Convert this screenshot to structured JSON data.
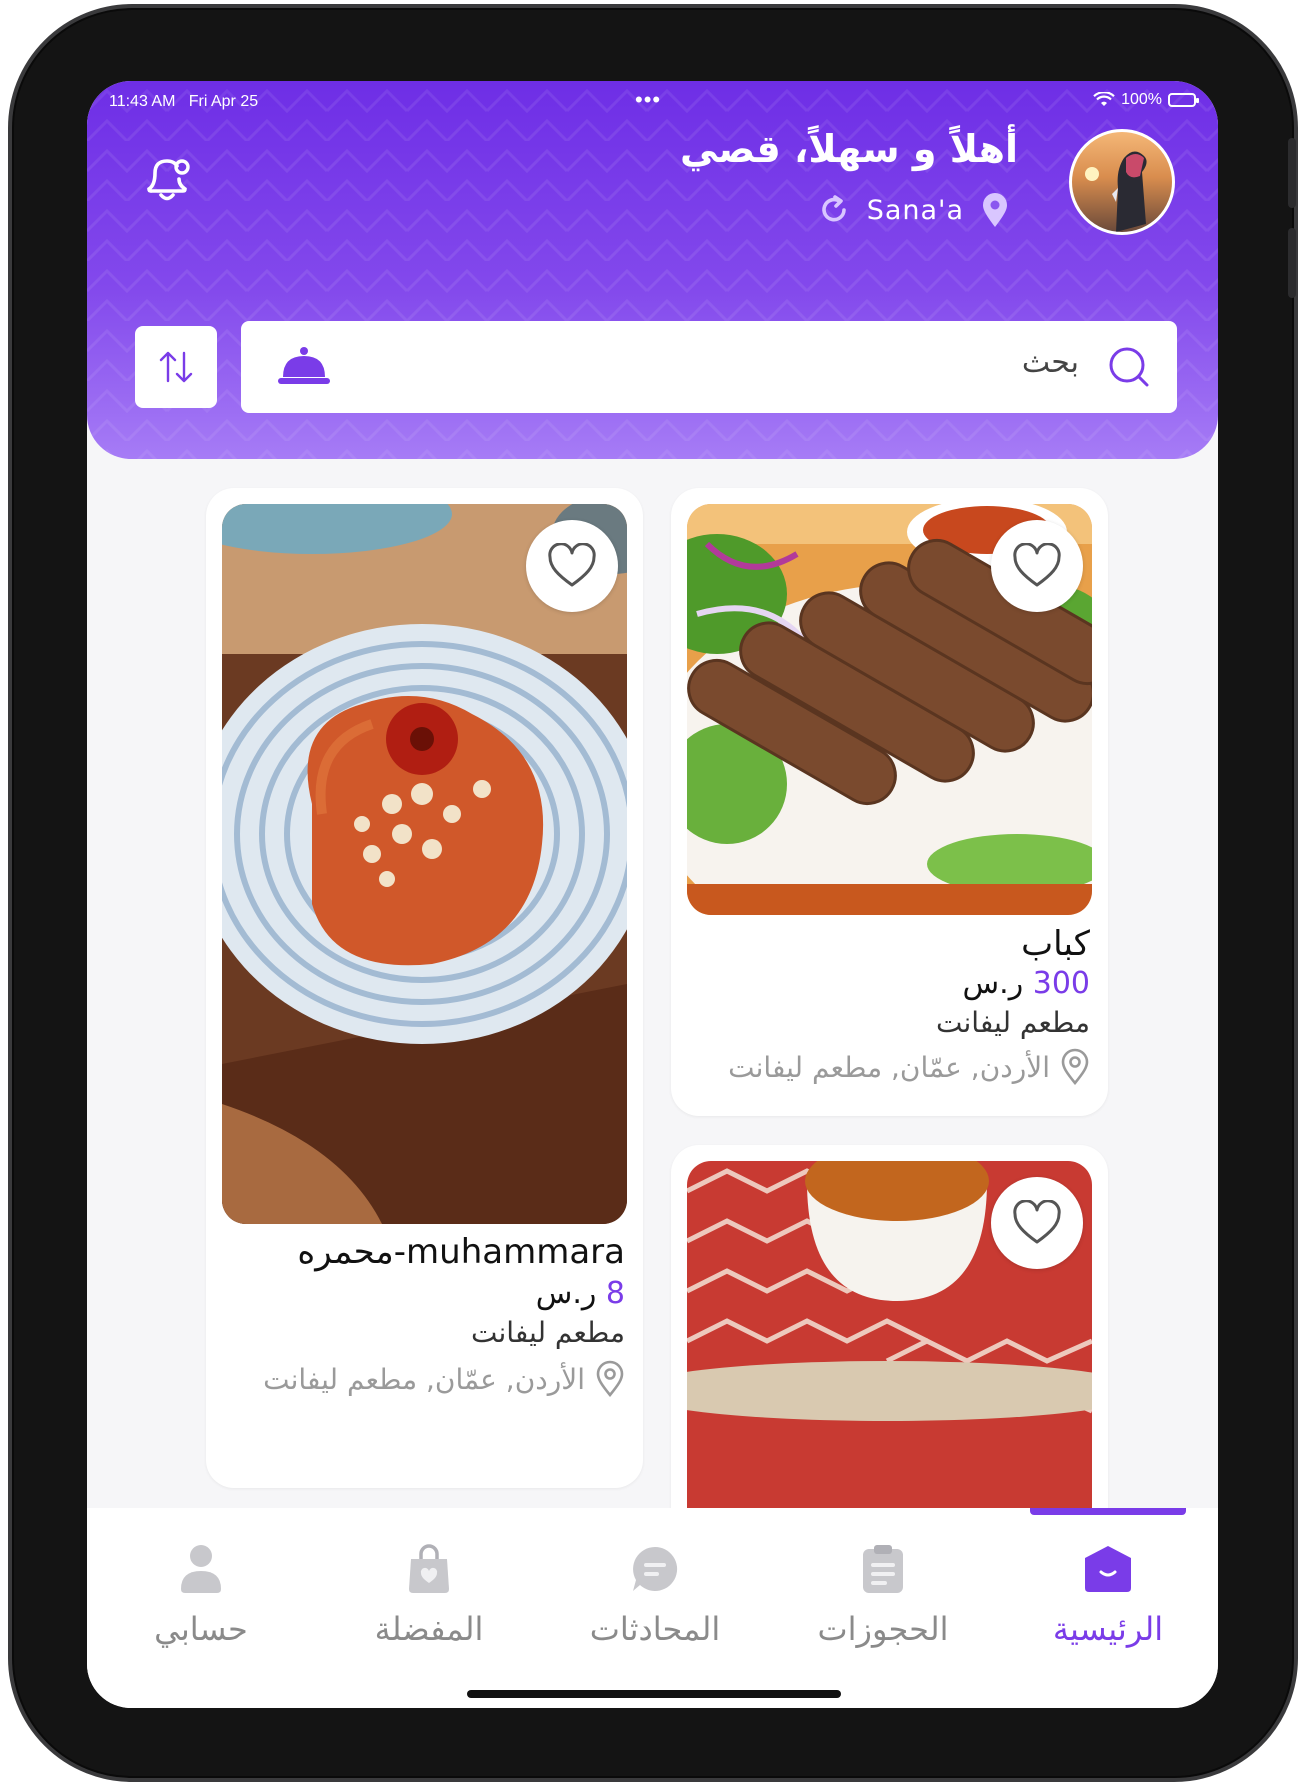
{
  "status": {
    "time": "11:43 AM",
    "date": "Fri Apr 25",
    "dots": "•••",
    "battery": "100%"
  },
  "header": {
    "greeting": "أهلاً و سهلاً، قصي",
    "city": "Sana'a",
    "accent_color": "#7a3ce8"
  },
  "search": {
    "placeholder": "بحث"
  },
  "cards": [
    {
      "title": "كباب",
      "price": "300",
      "currency": "ر.س",
      "restaurant": "مطعم ليفانت",
      "address": "الأردن, عمّان, مطعم ليفانت"
    },
    {
      "title": "muhammara-محمره",
      "price": "8",
      "currency": "ر.س",
      "restaurant": "مطعم ليفانت",
      "address": "الأردن, عمّان, مطعم ليفانت"
    },
    {
      "title": ""
    }
  ],
  "tabs": [
    {
      "label": "الرئيسية",
      "icon": "home-icon",
      "active": true
    },
    {
      "label": "الحجوزات",
      "icon": "clipboard-icon",
      "active": false
    },
    {
      "label": "المحادثات",
      "icon": "chat-icon",
      "active": false
    },
    {
      "label": "المفضلة",
      "icon": "favorites-bag-icon",
      "active": false
    },
    {
      "label": "حسابي",
      "icon": "user-icon",
      "active": false
    }
  ]
}
